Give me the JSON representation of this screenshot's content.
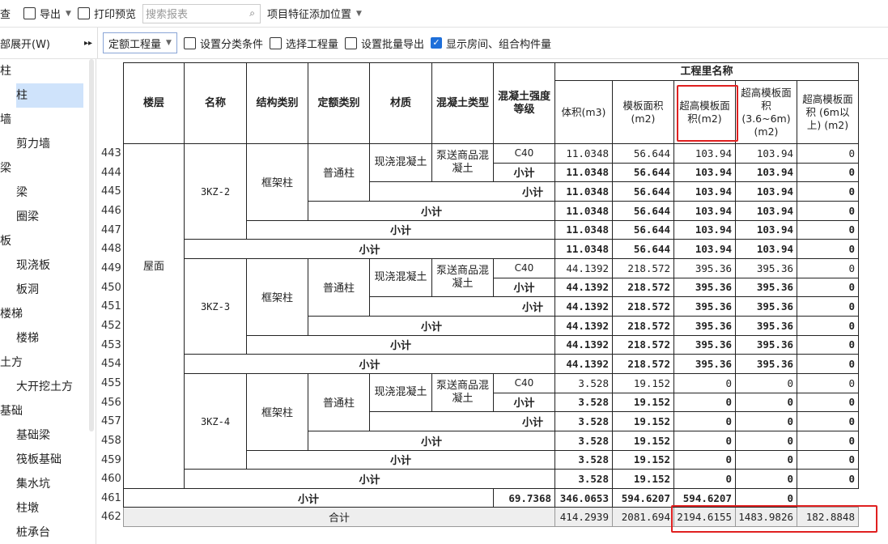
{
  "toolbar": {
    "query_label": "查",
    "export_label": "导出",
    "print_label": "打印预览",
    "search_placeholder": "搜索报表",
    "feature_label": "项目特征添加位置"
  },
  "toolbar2": {
    "expand_label": "部展开(W)",
    "quota_select": "定额工程量",
    "set_category": "设置分类条件",
    "select_quantity": "选择工程量",
    "batch_export": "设置批量导出",
    "show_rooms": "显示房间、组合构件量"
  },
  "sidebar": {
    "items": [
      {
        "label": "柱",
        "level": 0
      },
      {
        "label": "柱",
        "level": 1,
        "selected": true
      },
      {
        "label": "墙",
        "level": 0
      },
      {
        "label": "剪力墙",
        "level": 1
      },
      {
        "label": "梁",
        "level": 0
      },
      {
        "label": "梁",
        "level": 1
      },
      {
        "label": "圈梁",
        "level": 1
      },
      {
        "label": "板",
        "level": 0
      },
      {
        "label": "现浇板",
        "level": 1
      },
      {
        "label": "板洞",
        "level": 1
      },
      {
        "label": "楼梯",
        "level": 0
      },
      {
        "label": "楼梯",
        "level": 1
      },
      {
        "label": "土方",
        "level": 0
      },
      {
        "label": "大开挖土方",
        "level": 1
      },
      {
        "label": "基础",
        "level": 0
      },
      {
        "label": "基础梁",
        "level": 1
      },
      {
        "label": "筏板基础",
        "level": 1
      },
      {
        "label": "集水坑",
        "level": 1
      },
      {
        "label": "柱墩",
        "level": 1
      },
      {
        "label": "桩承台",
        "level": 1
      }
    ]
  },
  "headers": {
    "floor": "楼层",
    "name": "名称",
    "struct_type": "结构类别",
    "quota_type": "定额类别",
    "material": "材质",
    "concrete_type": "混凝土类型",
    "strength": "混凝土强度等级",
    "group": "工程里名称",
    "volume": "体积(m3)",
    "formwork": "模板面积(m2)",
    "super_formwork": "超高模板面积(m2)",
    "super_36": "超高模板面积 (3.6~6m) (m2)",
    "super_6": "超高模板面积 (6m以上) (m2)"
  },
  "labels": {
    "subtotal": "小计",
    "total": "合计",
    "floor_value": "屋面",
    "struct_value": "框架柱",
    "quota_value": "普通柱",
    "material_value": "现浇混凝土",
    "concrete_value": "泵送商品混凝土",
    "strength_value": "C40"
  },
  "row_numbers": [
    "443",
    "444",
    "445",
    "446",
    "447",
    "448",
    "449",
    "450",
    "451",
    "452",
    "453",
    "454",
    "455",
    "456",
    "457",
    "458",
    "459",
    "460",
    "461",
    "462"
  ],
  "groups": [
    {
      "name": "3KZ-2",
      "first": [
        "11.0348",
        "56.644",
        "103.94",
        "103.94",
        "0"
      ],
      "sub": [
        "11.0348",
        "56.644",
        "103.94",
        "103.94",
        "0"
      ]
    },
    {
      "name": "3KZ-3",
      "first": [
        "44.1392",
        "218.572",
        "395.36",
        "395.36",
        "0"
      ],
      "sub": [
        "44.1392",
        "218.572",
        "395.36",
        "395.36",
        "0"
      ]
    },
    {
      "name": "3KZ-4",
      "first": [
        "3.528",
        "19.152",
        "0",
        "0",
        "0"
      ],
      "sub": [
        "3.528",
        "19.152",
        "0",
        "0",
        "0"
      ]
    }
  ],
  "floor_subtotal": [
    "69.7368",
    "346.0653",
    "594.6207",
    "594.6207",
    "0"
  ],
  "grand_total": [
    "414.2939",
    "2081.694",
    "2194.6155",
    "1483.9826",
    "182.8848"
  ]
}
